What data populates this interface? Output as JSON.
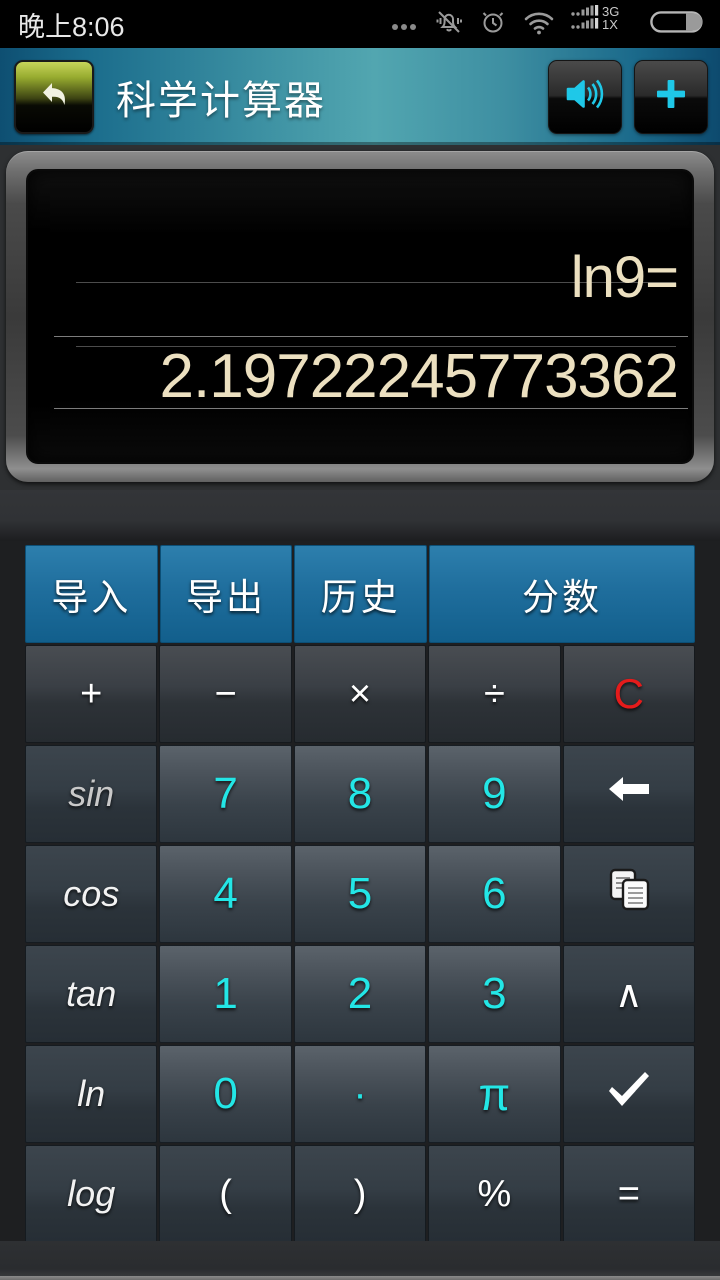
{
  "statusbar": {
    "time": "晚上8:06",
    "icons": [
      {
        "name": "more-dots-icon",
        "label": "..."
      },
      {
        "name": "mute-bell-icon",
        "label": "silent"
      },
      {
        "name": "alarm-clock-icon",
        "label": "alarm"
      },
      {
        "name": "wifi-icon",
        "label": "wifi"
      },
      {
        "name": "signal-bars-icon",
        "label": "signal"
      },
      {
        "name": "battery-icon",
        "label": "battery"
      }
    ],
    "network_top": "3G",
    "network_bottom": "1X"
  },
  "titlebar": {
    "title": "科学计算器",
    "back_icon": "back-arrow-icon",
    "sound_icon": "speaker-icon",
    "add_icon": "plus-icon"
  },
  "display": {
    "expression": "ln9=",
    "result": "2.19722245773362"
  },
  "keypad": {
    "rows": [
      [
        {
          "label": "导入",
          "style": "blue",
          "name": "import-button",
          "span": 1
        },
        {
          "label": "导出",
          "style": "blue",
          "name": "export-button",
          "span": 1
        },
        {
          "label": "历史",
          "style": "blue",
          "name": "history-button",
          "span": 1
        },
        {
          "label": "分数",
          "style": "blue",
          "name": "fraction-button",
          "span": 2
        }
      ],
      [
        {
          "label": "+",
          "style": "op",
          "name": "add-button",
          "span": 1
        },
        {
          "label": "−",
          "style": "op",
          "name": "subtract-button",
          "span": 1
        },
        {
          "label": "×",
          "style": "op",
          "name": "multiply-button",
          "span": 1
        },
        {
          "label": "÷",
          "style": "op",
          "name": "divide-button",
          "span": 1
        },
        {
          "label": "C",
          "style": "op clear",
          "name": "clear-button",
          "span": 1
        }
      ],
      [
        {
          "label": "sin",
          "style": "fn dim",
          "name": "sin-button",
          "span": 1
        },
        {
          "label": "7",
          "style": "num",
          "name": "digit-7-button",
          "span": 1
        },
        {
          "label": "8",
          "style": "num",
          "name": "digit-8-button",
          "span": 1
        },
        {
          "label": "9",
          "style": "num",
          "name": "digit-9-button",
          "span": 1
        },
        {
          "label": "",
          "style": "side",
          "name": "backspace-button",
          "icon": "backspace-arrow-icon",
          "span": 1
        }
      ],
      [
        {
          "label": "cos",
          "style": "fn",
          "name": "cos-button",
          "span": 1
        },
        {
          "label": "4",
          "style": "num",
          "name": "digit-4-button",
          "span": 1
        },
        {
          "label": "5",
          "style": "num",
          "name": "digit-5-button",
          "span": 1
        },
        {
          "label": "6",
          "style": "num",
          "name": "digit-6-button",
          "span": 1
        },
        {
          "label": "",
          "style": "side",
          "name": "copy-button",
          "icon": "copy-icon",
          "span": 1
        }
      ],
      [
        {
          "label": "tan",
          "style": "fn",
          "name": "tan-button",
          "span": 1
        },
        {
          "label": "1",
          "style": "num",
          "name": "digit-1-button",
          "span": 1
        },
        {
          "label": "2",
          "style": "num",
          "name": "digit-2-button",
          "span": 1
        },
        {
          "label": "3",
          "style": "num",
          "name": "digit-3-button",
          "span": 1
        },
        {
          "label": "∧",
          "style": "side",
          "name": "power-button",
          "span": 1
        }
      ],
      [
        {
          "label": "ln",
          "style": "fn",
          "name": "ln-button",
          "span": 1
        },
        {
          "label": "0",
          "style": "num",
          "name": "digit-0-button",
          "span": 1
        },
        {
          "label": "·",
          "style": "num dotkey",
          "name": "decimal-point-button",
          "span": 1
        },
        {
          "label": "π",
          "style": "num pikey",
          "name": "pi-button",
          "span": 1
        },
        {
          "label": "",
          "style": "side",
          "name": "sqrt-check-button",
          "icon": "check-icon",
          "span": 1
        }
      ],
      [
        {
          "label": "log",
          "style": "fn",
          "name": "log-button",
          "span": 1
        },
        {
          "label": "(",
          "style": "side",
          "name": "left-paren-button",
          "span": 1
        },
        {
          "label": ")",
          "style": "side",
          "name": "right-paren-button",
          "span": 1
        },
        {
          "label": "%",
          "style": "side",
          "name": "percent-button",
          "span": 1
        },
        {
          "label": "=",
          "style": "side",
          "name": "equals-button",
          "span": 1
        }
      ]
    ]
  },
  "colors": {
    "accent_cyan": "#23e6e6",
    "blue_button": "#1f6e9d",
    "clear_red": "#e51b1b",
    "display_text": "#ece0c0",
    "header_teal": "#52a6b0"
  }
}
